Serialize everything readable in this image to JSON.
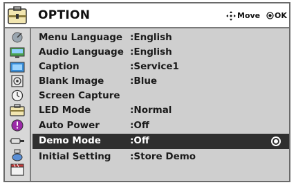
{
  "header": {
    "title": "OPTION",
    "hints": [
      {
        "icon": "dpad-icon",
        "label": "Move"
      },
      {
        "icon": "ok-button-icon",
        "label": "OK"
      }
    ]
  },
  "sidebar_icons": [
    "satellite-icon",
    "monitor-icon",
    "picture-icon",
    "audio-icon",
    "clock-icon",
    "option-icon",
    "power-icon",
    "input-icon",
    "usb-icon",
    "film-icon"
  ],
  "menu": {
    "selected_index": 7,
    "items": [
      {
        "label": "Menu Language",
        "value": ":English"
      },
      {
        "label": "Audio Language",
        "value": ":English"
      },
      {
        "label": "Caption",
        "value": ":Service1"
      },
      {
        "label": "Blank Image",
        "value": ":Blue"
      },
      {
        "label": "Screen Capture",
        "value": ""
      },
      {
        "label": "LED Mode",
        "value": ":Normal"
      },
      {
        "label": "Auto Power",
        "value": ":Off"
      },
      {
        "label": "Demo Mode",
        "value": ":Off"
      },
      {
        "label": "Initial Setting",
        "value": ":Store Demo"
      }
    ]
  }
}
